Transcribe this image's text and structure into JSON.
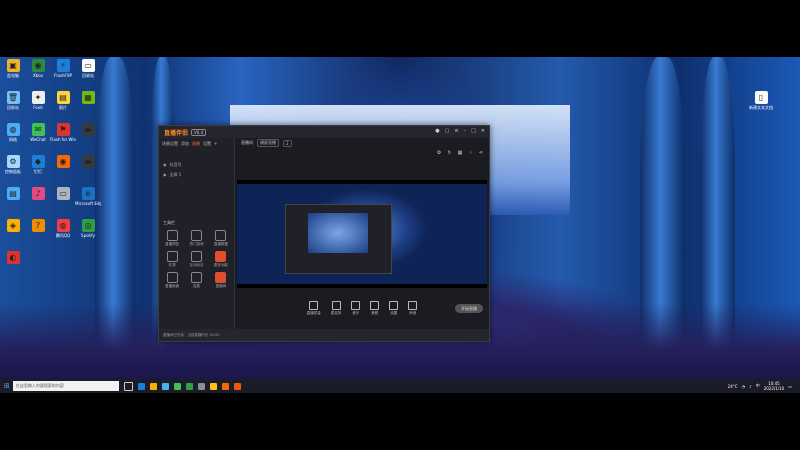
{
  "desktop": {
    "icons": [
      {
        "label": "此电脑",
        "color": "#f0b429",
        "glyph": "▣"
      },
      {
        "label": "Xbox",
        "color": "#2b8a3e",
        "glyph": "◉"
      },
      {
        "label": "FlashFXP",
        "color": "#1c7ed6",
        "glyph": "⚡"
      },
      {
        "label": "回收站",
        "color": "#ffffff",
        "glyph": "▭"
      },
      {
        "label": "回收站",
        "color": "#74c0fc",
        "glyph": "🗑"
      },
      {
        "label": "Foxit",
        "color": "#eeeeee",
        "glyph": "✦"
      },
      {
        "label": "图片",
        "color": "#ffd43b",
        "glyph": "▤"
      },
      {
        "label": "",
        "color": "#74b816",
        "glyph": "▦"
      },
      {
        "label": "网络",
        "color": "#4dabf7",
        "glyph": "◍"
      },
      {
        "label": "WeChat",
        "color": "#40c057",
        "glyph": "✉"
      },
      {
        "label": "Flash for Windows",
        "color": "#e03131",
        "glyph": "⚑"
      },
      {
        "label": "",
        "color": "#343a40",
        "glyph": "▬"
      },
      {
        "label": "控制面板",
        "color": "#a5d8ff",
        "glyph": "⚙"
      },
      {
        "label": "钉钉",
        "color": "#1c7ed6",
        "glyph": "◆"
      },
      {
        "label": "",
        "color": "#f76707",
        "glyph": "◉"
      },
      {
        "label": "",
        "color": "#343a40",
        "glyph": "▬"
      },
      {
        "label": "",
        "color": "#4dabf7",
        "glyph": "▤"
      },
      {
        "label": "",
        "color": "#e64980",
        "glyph": "♪"
      },
      {
        "label": "",
        "color": "#adb5bd",
        "glyph": "▭"
      },
      {
        "label": "Microsoft Edge",
        "color": "#1971c2",
        "glyph": "e"
      },
      {
        "label": "",
        "color": "#fab005",
        "glyph": "◈"
      },
      {
        "label": "",
        "color": "#f08c00",
        "glyph": "?"
      },
      {
        "label": "腾讯QQ",
        "color": "#f03e3e",
        "glyph": "◍"
      },
      {
        "label": "Spotify",
        "color": "#2f9e44",
        "glyph": "◎"
      },
      {
        "label": "",
        "color": "#e03131",
        "glyph": "◐"
      }
    ],
    "right_icon": {
      "label": "新建文本文档",
      "glyph": "▯"
    }
  },
  "app": {
    "title": "直播伴侣",
    "version_badge": "V6.4",
    "tabs": [
      "场景设置",
      "添加",
      "直播",
      "设置"
    ],
    "active_tab": "直播",
    "sources": [
      "抖音号",
      "全屏 1"
    ],
    "tools_title": "工具栏",
    "tools": [
      "直播预告",
      "热门游戏",
      "直播数据",
      "礼物",
      "互动玩法",
      "更多功能",
      "直播画面",
      "连麦",
      "直播间"
    ],
    "scene_label": "直播间",
    "scene_chips": [
      "横屏直播",
      "2"
    ],
    "bottom_tools": [
      "直播质量",
      "麦克风",
      "音乐",
      "美颜",
      "设置",
      "声音"
    ],
    "live_button": "开始直播",
    "status_text": "直播间已开启 · 当前直播时长 00:00"
  },
  "taskbar": {
    "search_placeholder": "在这里输入你要搜索的内容",
    "time": "10:45",
    "date": "2022/1/10",
    "weather": "24°C",
    "lang": "中"
  }
}
